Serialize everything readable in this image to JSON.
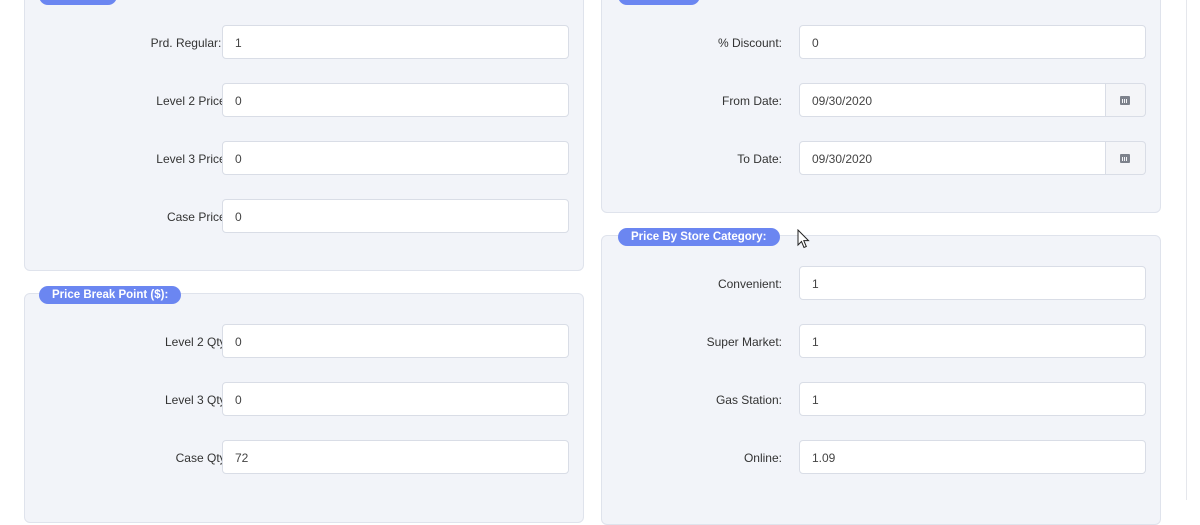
{
  "pricing_panel": {
    "fields": [
      {
        "label": "Prd. Regular:",
        "required": "*",
        "value": "1"
      },
      {
        "label": "Level 2 Price:",
        "value": "0"
      },
      {
        "label": "Level 3 Price:",
        "value": "0"
      },
      {
        "label": "Case Price:",
        "value": "0"
      }
    ]
  },
  "price_break_point": {
    "legend": "Price Break Point ($):",
    "fields": [
      {
        "label": "Level 2 Qty:",
        "value": "0"
      },
      {
        "label": "Level 3 Qty:",
        "value": "0"
      },
      {
        "label": "Case Qty:",
        "value": "72"
      }
    ]
  },
  "discount_panel": {
    "fields": [
      {
        "label": "% Discount:",
        "value": "0"
      },
      {
        "label": "From Date:",
        "value": "09/30/2020",
        "icon": "calendar-icon"
      },
      {
        "label": "To Date:",
        "value": "09/30/2020",
        "icon": "calendar-icon"
      }
    ]
  },
  "price_by_store_category": {
    "legend": "Price By Store Category:",
    "fields": [
      {
        "label": "Convenient:",
        "value": "1"
      },
      {
        "label": "Super Market:",
        "value": "1"
      },
      {
        "label": "Gas Station:",
        "value": "1"
      },
      {
        "label": "Online:",
        "value": "1.09"
      }
    ]
  },
  "colors": {
    "legend_bg": "#6b86f1",
    "panel_bg": "#f2f4f9",
    "required": "#e8483e"
  }
}
